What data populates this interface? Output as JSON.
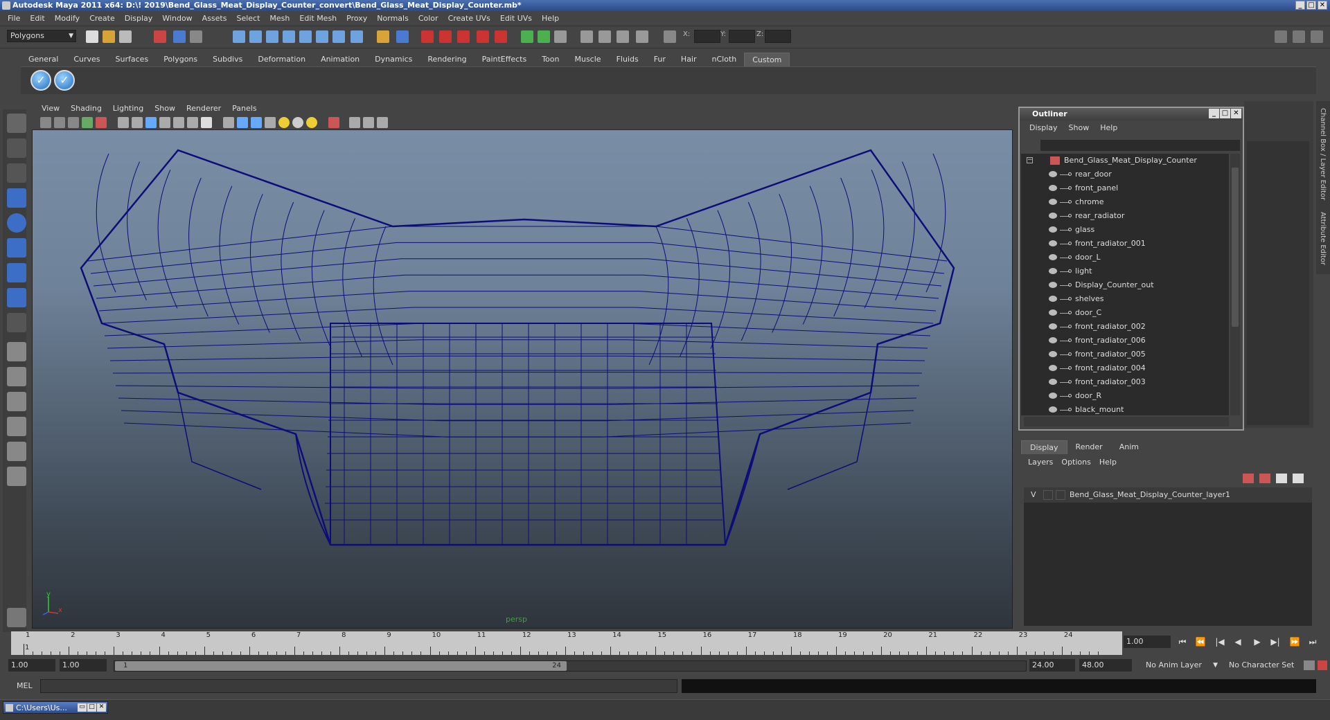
{
  "window": {
    "title": "Autodesk Maya 2011 x64: D:\\! 2019\\Bend_Glass_Meat_Display_Counter_convert\\Bend_Glass_Meat_Display_Counter.mb*",
    "controls": [
      "_",
      "□",
      "✕"
    ]
  },
  "menubar": [
    "File",
    "Edit",
    "Modify",
    "Create",
    "Display",
    "Window",
    "Assets",
    "Select",
    "Mesh",
    "Edit Mesh",
    "Proxy",
    "Normals",
    "Color",
    "Create UVs",
    "Edit UVs",
    "Help"
  ],
  "statusline": {
    "mode": "Polygons",
    "x_label": "X:",
    "y_label": "Y:",
    "z_label": "Z:"
  },
  "shelf": {
    "tabs": [
      "General",
      "Curves",
      "Surfaces",
      "Polygons",
      "Subdivs",
      "Deformation",
      "Animation",
      "Dynamics",
      "Rendering",
      "PaintEffects",
      "Toon",
      "Muscle",
      "Fluids",
      "Fur",
      "Hair",
      "nCloth",
      "Custom"
    ],
    "active_tab": "Custom",
    "buttons": [
      "check-icon",
      "check-icon"
    ]
  },
  "viewport": {
    "menu": [
      "View",
      "Shading",
      "Lighting",
      "Show",
      "Renderer",
      "Panels"
    ],
    "camera": "persp",
    "axis_y": "y",
    "axis_x": "x",
    "wire_color": "#0d0d7a"
  },
  "outliner": {
    "title": "Outliner",
    "controls": [
      "_",
      "□",
      "✕"
    ],
    "menu": [
      "Display",
      "Show",
      "Help"
    ],
    "root": "Bend_Glass_Meat_Display_Counter",
    "items": [
      "rear_door",
      "front_panel",
      "chrome",
      "rear_radiator",
      "glass",
      "front_radiator_001",
      "door_L",
      "light",
      "Display_Counter_out",
      "shelves",
      "door_C",
      "front_radiator_002",
      "front_radiator_006",
      "front_radiator_005",
      "front_radiator_004",
      "front_radiator_003",
      "door_R",
      "black_mount"
    ]
  },
  "side_tabs": [
    "Channel Box / Layer Editor",
    "Attribute Editor"
  ],
  "layer_editor": {
    "tabs": [
      "Display",
      "Render",
      "Anim"
    ],
    "active_tab": "Display",
    "menu": [
      "Layers",
      "Options",
      "Help"
    ],
    "layer": {
      "visible": "V",
      "name": "Bend_Glass_Meat_Display_Counter_layer1"
    }
  },
  "timeline": {
    "ticks": [
      "1",
      "2",
      "3",
      "4",
      "5",
      "6",
      "7",
      "8",
      "9",
      "10",
      "11",
      "12",
      "13",
      "14",
      "15",
      "16",
      "17",
      "18",
      "19",
      "20",
      "21",
      "22",
      "23",
      "24"
    ],
    "current_marker": "1",
    "current_frame": "1.00",
    "playback": [
      "⏮",
      "⏪",
      "|◀",
      "◀",
      "▶",
      "▶|",
      "⏩",
      "⏭"
    ]
  },
  "range": {
    "start": "1.00",
    "playback_start": "1.00",
    "handle_start": "1",
    "handle_end": "24",
    "playback_end": "24.00",
    "end": "48.00",
    "anim_layer": "No Anim Layer",
    "character_set": "No Character Set"
  },
  "command_line": {
    "label": "MEL"
  },
  "taskbar": {
    "item": "C:\\Users\\Us..."
  }
}
